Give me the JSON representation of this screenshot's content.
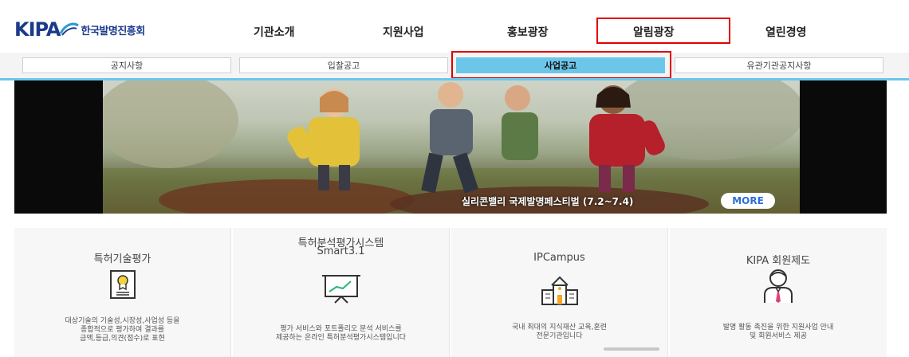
{
  "header": {
    "logo_mark": "KIPA",
    "logo_text": "한국발명진흥회",
    "nav": [
      {
        "label": "기관소개"
      },
      {
        "label": "지원사업"
      },
      {
        "label": "홍보광장"
      },
      {
        "label": "알림광장"
      },
      {
        "label": "열린경영"
      }
    ],
    "highlighted_nav": "알림광장"
  },
  "subnav": {
    "tabs": [
      {
        "label": "공지사항"
      },
      {
        "label": "입찰공고"
      },
      {
        "label": "사업공고"
      },
      {
        "label": "유관기관공지사항"
      }
    ],
    "active_tab": "사업공고",
    "accent_color": "#6cc6ea",
    "highlight_color": "#e10000"
  },
  "hero": {
    "caption": "실리콘밸리 국제발명페스티벌 (7.2~7.4)",
    "more_label": "MORE"
  },
  "cards": [
    {
      "title": "특허기술평가",
      "title2": "",
      "icon": "certificate-icon",
      "desc": [
        "대상기술의 기술성,시장성,사업성 등을",
        "종합적으로 평가하여 결과를",
        "금액,등급,의견(점수)로 표현"
      ]
    },
    {
      "title": "특허분석평가시스템",
      "title2": "Smart3.1",
      "icon": "presentation-chart-icon",
      "desc": [
        "평가 서비스와 포트폴리오 분석 서비스를",
        "제공하는 온라인 특허분석평가시스템입니다"
      ]
    },
    {
      "title": "IPCampus",
      "title2": "",
      "icon": "campus-building-icon",
      "desc": [
        "국내 최대의 지식재산 교육,훈련",
        "전문기관입니다"
      ]
    },
    {
      "title": "KIPA 회원제도",
      "title2": "",
      "icon": "member-person-icon",
      "desc": [
        "발명 활동 촉진을 위한 지원사업 안내",
        "및 회원서비스 제공"
      ]
    }
  ]
}
